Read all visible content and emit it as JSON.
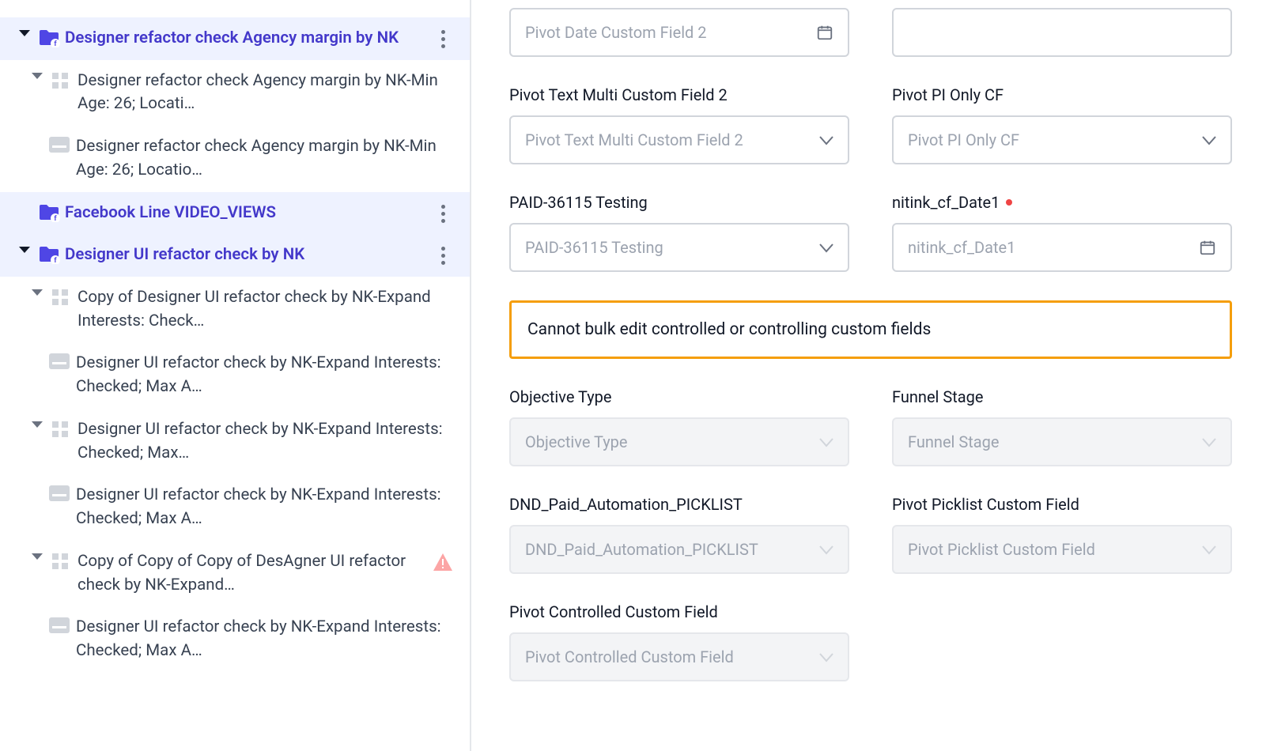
{
  "sidebar": {
    "items": [
      {
        "kind": "campaign",
        "level": 0,
        "expanded": true,
        "label": "Designer refactor check Agency margin by NK",
        "more": true
      },
      {
        "kind": "adset",
        "level": 1,
        "expanded": true,
        "label": "Designer refactor check Agency margin by NK-Min Age: 26; Locati…"
      },
      {
        "kind": "ad",
        "level": 2,
        "label": "Designer refactor check Agency margin by NK-Min Age: 26; Locatio…"
      },
      {
        "kind": "campaign",
        "level": 0,
        "noToggle": true,
        "label": "Facebook Line VIDEO_VIEWS",
        "more": true
      },
      {
        "kind": "campaign",
        "level": 0,
        "expanded": true,
        "label": "Designer UI refactor check by NK",
        "more": true
      },
      {
        "kind": "adset",
        "level": 1,
        "expanded": true,
        "label": "Copy of Designer UI refactor check by NK-Expand Interests: Check…"
      },
      {
        "kind": "ad",
        "level": 2,
        "label": "Designer UI refactor check by NK-Expand Interests: Checked; Max A…"
      },
      {
        "kind": "adset",
        "level": 1,
        "expanded": true,
        "label": "Designer UI refactor check by NK-Expand Interests: Checked; Max…"
      },
      {
        "kind": "ad",
        "level": 2,
        "label": "Designer UI refactor check by NK-Expand Interests: Checked; Max A…"
      },
      {
        "kind": "adset",
        "level": 1,
        "expanded": true,
        "label": "Copy of Copy of Copy of DesAgner UI refactor check by NK-Expand…",
        "warn": true
      },
      {
        "kind": "ad",
        "level": 2,
        "label": "Designer UI refactor check by NK-Expand Interests: Checked; Max A…"
      }
    ]
  },
  "form": {
    "pivotDate2": {
      "label": "",
      "placeholder": "Pivot Date Custom Field 2"
    },
    "emptyRight": {},
    "pivotTextMulti2": {
      "label": "Pivot Text Multi Custom Field 2",
      "placeholder": "Pivot Text Multi Custom Field 2"
    },
    "pivotPIOnly": {
      "label": "Pivot PI Only CF",
      "placeholder": "Pivot PI Only CF"
    },
    "paid36115": {
      "label": "PAID-36115 Testing",
      "placeholder": "PAID-36115 Testing"
    },
    "nitinkDate1": {
      "label": "nitink_cf_Date1",
      "placeholder": "nitink_cf_Date1",
      "required": true
    },
    "warning": "Cannot bulk edit controlled or controlling custom fields",
    "objectiveType": {
      "label": "Objective Type",
      "placeholder": "Objective Type"
    },
    "funnelStage": {
      "label": "Funnel Stage",
      "placeholder": "Funnel Stage"
    },
    "dndPicklist": {
      "label": "DND_Paid_Automation_PICKLIST",
      "placeholder": "DND_Paid_Automation_PICKLIST"
    },
    "pivotPicklist": {
      "label": "Pivot Picklist Custom Field",
      "placeholder": "Pivot Picklist Custom Field"
    },
    "pivotControlled": {
      "label": "Pivot Controlled Custom Field",
      "placeholder": "Pivot Controlled Custom Field"
    }
  }
}
